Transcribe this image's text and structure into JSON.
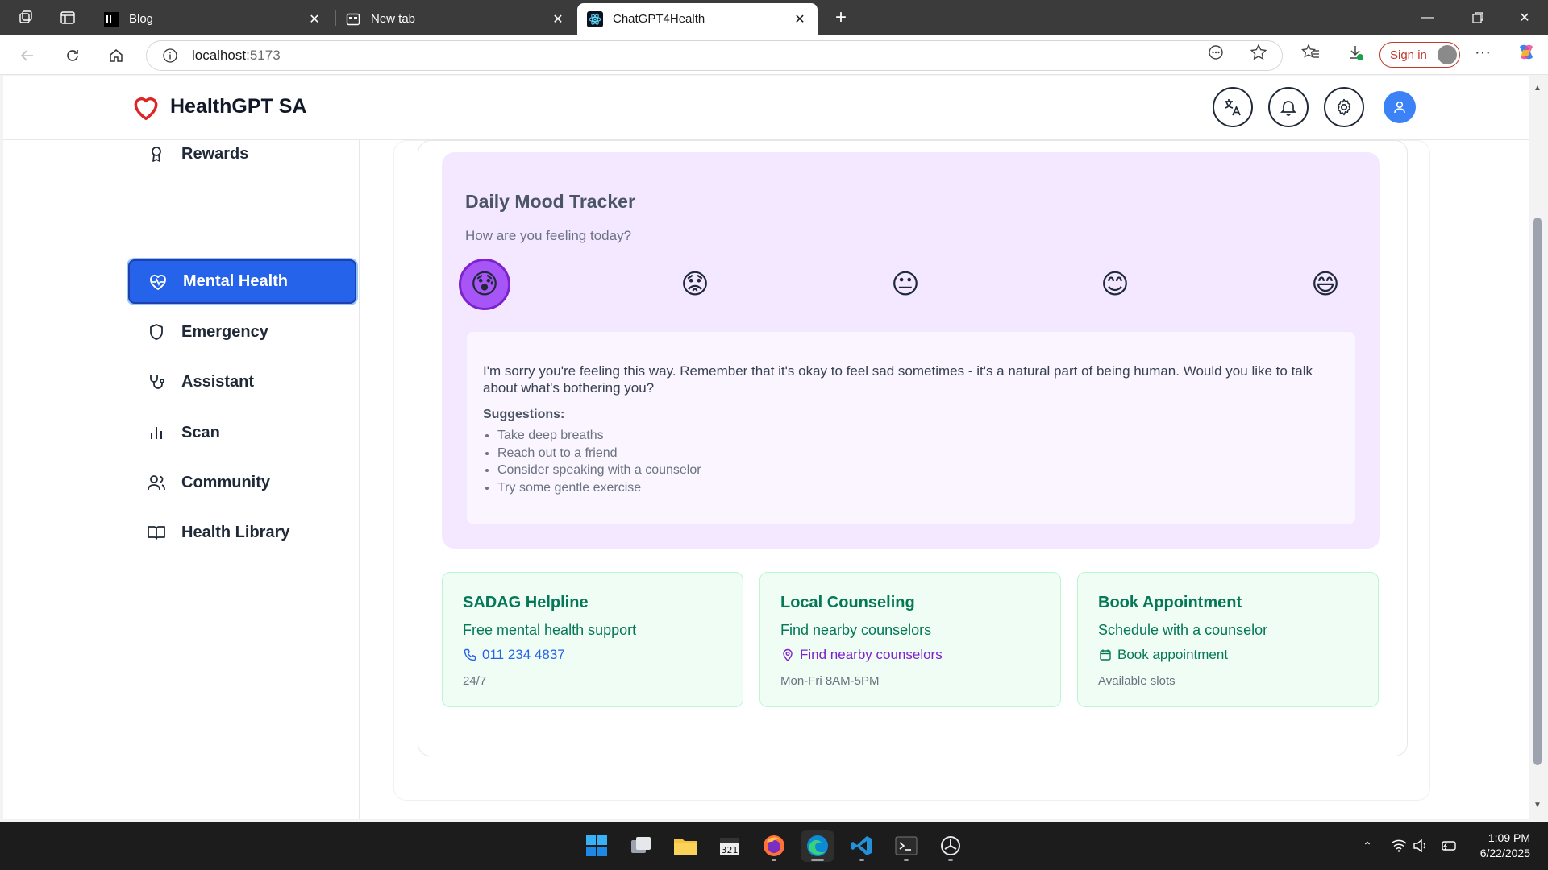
{
  "browser": {
    "tabs": [
      {
        "title": "Blog"
      },
      {
        "title": "New tab"
      },
      {
        "title": "ChatGPT4Health"
      }
    ],
    "url_host": "localhost",
    "url_port": ":5173",
    "signin_label": "Sign in"
  },
  "app": {
    "name": "HealthGPT SA",
    "brand_color": "#dc2626",
    "accent_color": "#2563eb"
  },
  "sidebar": {
    "items": [
      {
        "label": "Rewards",
        "icon": "award-icon"
      },
      {
        "label": "Mental Health",
        "icon": "heart-pulse-icon",
        "active": true
      },
      {
        "label": "Emergency",
        "icon": "shield-icon"
      },
      {
        "label": "Assistant",
        "icon": "stethoscope-icon"
      },
      {
        "label": "Scan",
        "icon": "bar-chart-icon"
      },
      {
        "label": "Community",
        "icon": "users-icon"
      },
      {
        "label": "Health Library",
        "icon": "book-open-icon"
      }
    ]
  },
  "mood": {
    "title": "Daily Mood Tracker",
    "prompt": "How are you feeling today?",
    "options": [
      {
        "emoji": "😰",
        "selected": true
      },
      {
        "emoji": "😟",
        "selected": false
      },
      {
        "emoji": "😐",
        "selected": false
      },
      {
        "emoji": "😊",
        "selected": false
      },
      {
        "emoji": "😄",
        "selected": false
      }
    ],
    "response": "I'm sorry you're feeling this way. Remember that it's okay to feel sad sometimes - it's a natural part of being human. Would you like to talk about what's bothering you?",
    "suggestions_title": "Suggestions:",
    "suggestions": [
      "Take deep breaths",
      "Reach out to a friend",
      "Consider speaking with a counselor",
      "Try some gentle exercise"
    ]
  },
  "resources": [
    {
      "title": "SADAG Helpline",
      "desc": "Free mental health support",
      "link": "011 234 4837",
      "link_icon": "phone-icon",
      "note": "24/7"
    },
    {
      "title": "Local Counseling",
      "desc": "Find nearby counselors",
      "link": "Find nearby counselors",
      "link_icon": "map-pin-icon",
      "note": "Mon-Fri 8AM-5PM"
    },
    {
      "title": "Book Appointment",
      "desc": "Schedule with a counselor",
      "link": "Book appointment",
      "link_icon": "calendar-icon",
      "note": "Available slots"
    }
  ],
  "taskbar": {
    "time": "1:09 PM",
    "date": "6/22/2025"
  }
}
